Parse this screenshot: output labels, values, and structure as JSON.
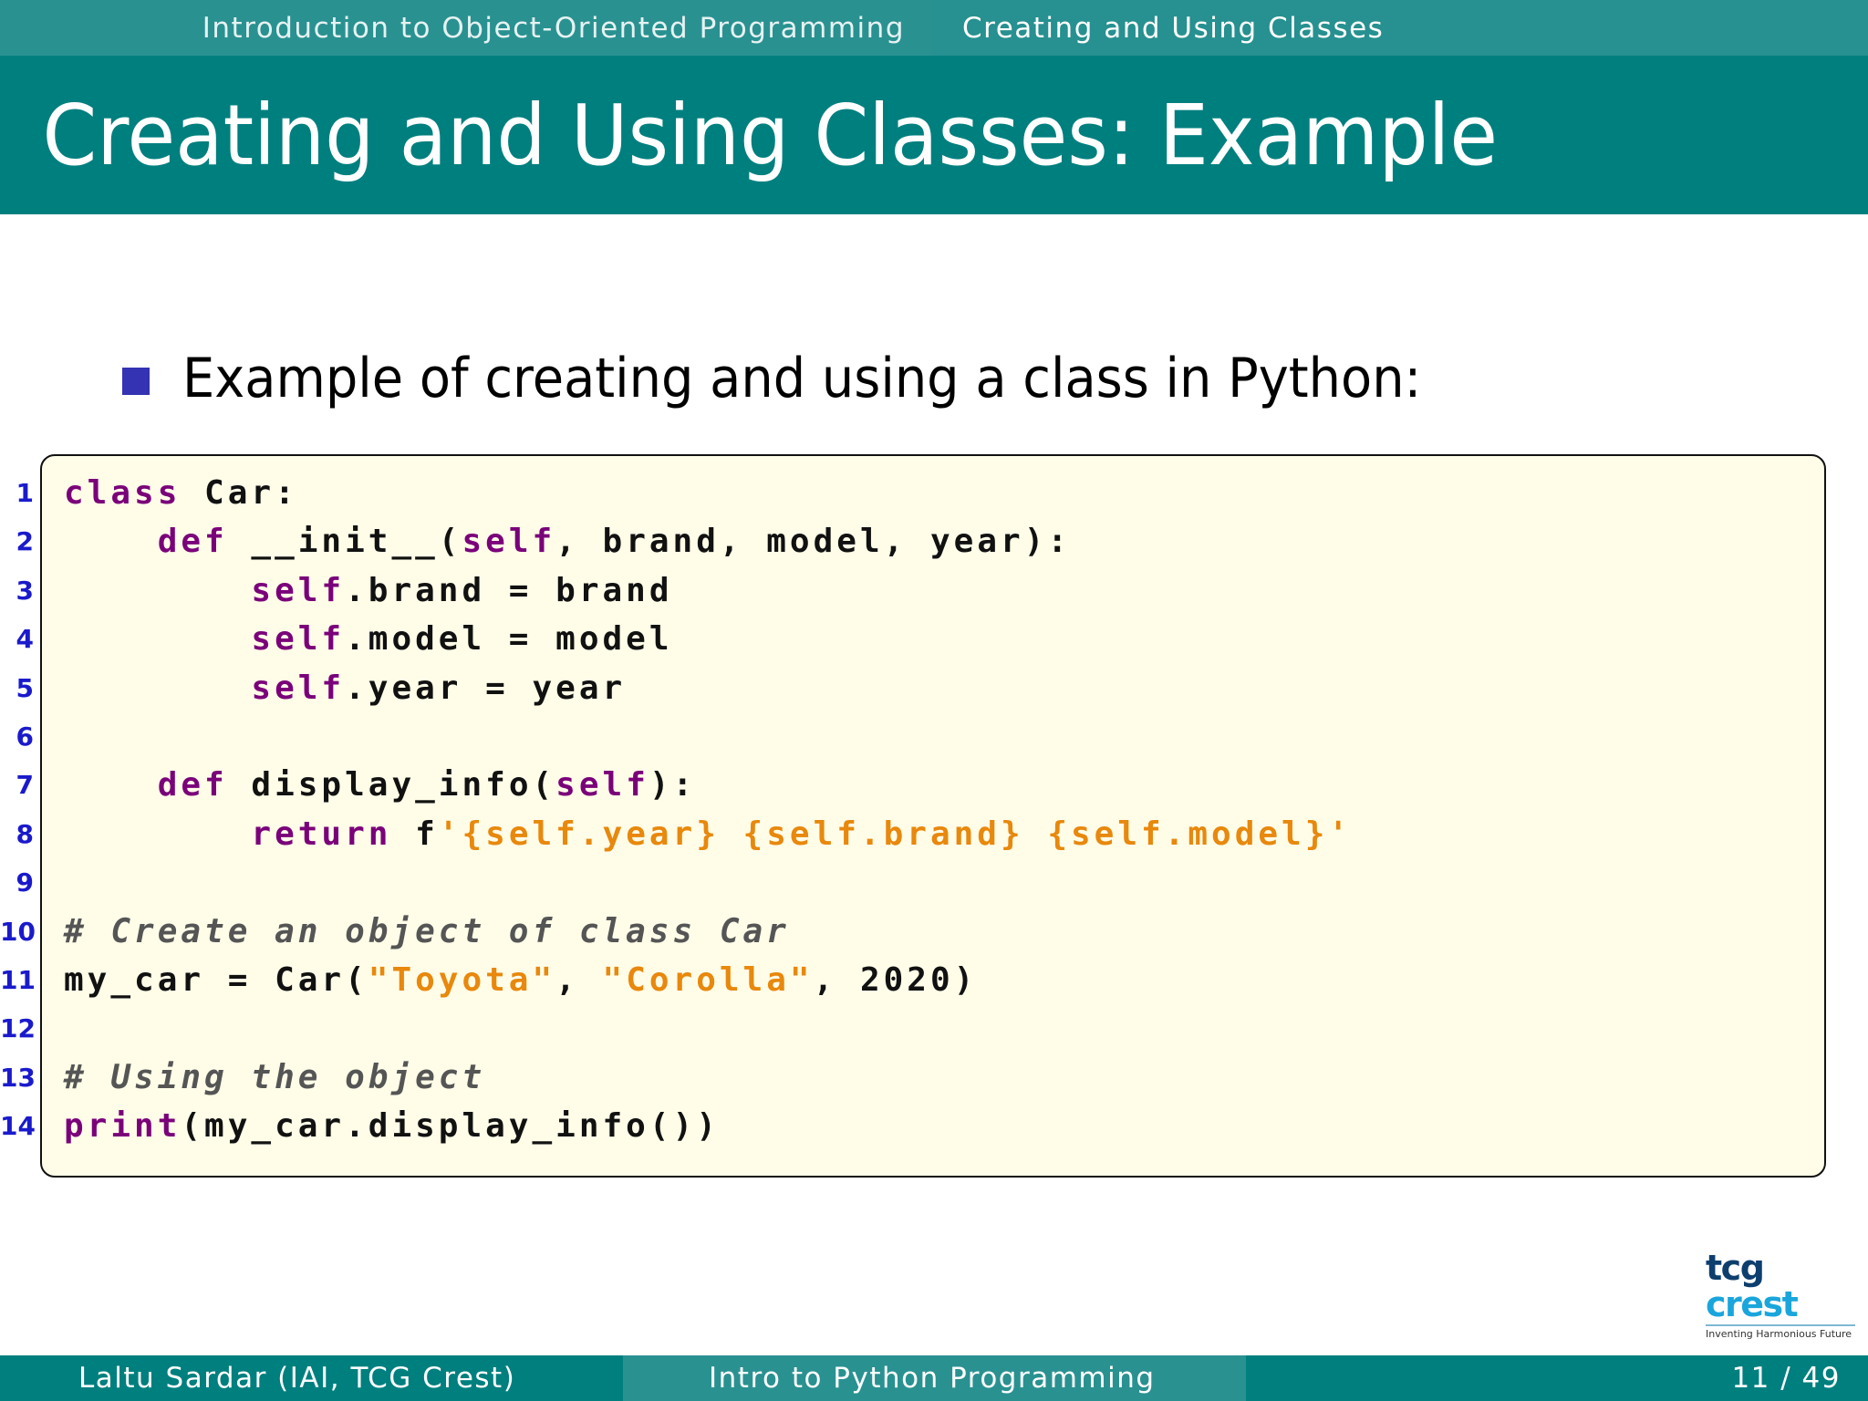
{
  "header": {
    "section": "Introduction to Object-Oriented Programming",
    "subsection": "Creating and Using Classes"
  },
  "title": "Creating and Using Classes: Example",
  "bullet": "Example of creating and using a class in Python:",
  "code": {
    "lines": [
      {
        "n": "1",
        "tokens": [
          {
            "t": "class",
            "c": "kw"
          },
          {
            "t": " Car:",
            "c": ""
          }
        ]
      },
      {
        "n": "2",
        "tokens": [
          {
            "t": "    ",
            "c": ""
          },
          {
            "t": "def",
            "c": "kw"
          },
          {
            "t": " __init__(",
            "c": ""
          },
          {
            "t": "self",
            "c": "kw"
          },
          {
            "t": ", brand, model, year):",
            "c": ""
          }
        ]
      },
      {
        "n": "3",
        "tokens": [
          {
            "t": "        ",
            "c": ""
          },
          {
            "t": "self",
            "c": "kw"
          },
          {
            "t": ".brand = brand",
            "c": ""
          }
        ]
      },
      {
        "n": "4",
        "tokens": [
          {
            "t": "        ",
            "c": ""
          },
          {
            "t": "self",
            "c": "kw"
          },
          {
            "t": ".model = model",
            "c": ""
          }
        ]
      },
      {
        "n": "5",
        "tokens": [
          {
            "t": "        ",
            "c": ""
          },
          {
            "t": "self",
            "c": "kw"
          },
          {
            "t": ".year = year",
            "c": ""
          }
        ]
      },
      {
        "n": "6",
        "tokens": []
      },
      {
        "n": "7",
        "tokens": [
          {
            "t": "    ",
            "c": ""
          },
          {
            "t": "def",
            "c": "kw"
          },
          {
            "t": " display_info(",
            "c": ""
          },
          {
            "t": "self",
            "c": "kw"
          },
          {
            "t": "):",
            "c": ""
          }
        ]
      },
      {
        "n": "8",
        "tokens": [
          {
            "t": "        ",
            "c": ""
          },
          {
            "t": "return",
            "c": "kw"
          },
          {
            "t": " f",
            "c": ""
          },
          {
            "t": "'{self.year} {self.brand} {self.model}'",
            "c": "str"
          }
        ]
      },
      {
        "n": "9",
        "tokens": []
      },
      {
        "n": "10",
        "tokens": [
          {
            "t": "# Create an object of class Car",
            "c": "cm"
          }
        ]
      },
      {
        "n": "11",
        "tokens": [
          {
            "t": "my_car = Car(",
            "c": ""
          },
          {
            "t": "\"Toyota\"",
            "c": "str"
          },
          {
            "t": ", ",
            "c": ""
          },
          {
            "t": "\"Corolla\"",
            "c": "str"
          },
          {
            "t": ", 2020)",
            "c": ""
          }
        ]
      },
      {
        "n": "12",
        "tokens": []
      },
      {
        "n": "13",
        "tokens": [
          {
            "t": "# Using the object",
            "c": "cm"
          }
        ]
      },
      {
        "n": "14",
        "tokens": [
          {
            "t": "print",
            "c": "kw"
          },
          {
            "t": "(my_car.display_info())",
            "c": ""
          }
        ]
      }
    ]
  },
  "logo": {
    "name_part1": "tcg",
    "name_part2": " crest",
    "tagline": "Inventing Harmonious Future"
  },
  "footer": {
    "author": "Laltu Sardar  (IAI, TCG Crest)",
    "course": "Intro to Python Programming",
    "page": "11 / 49"
  }
}
